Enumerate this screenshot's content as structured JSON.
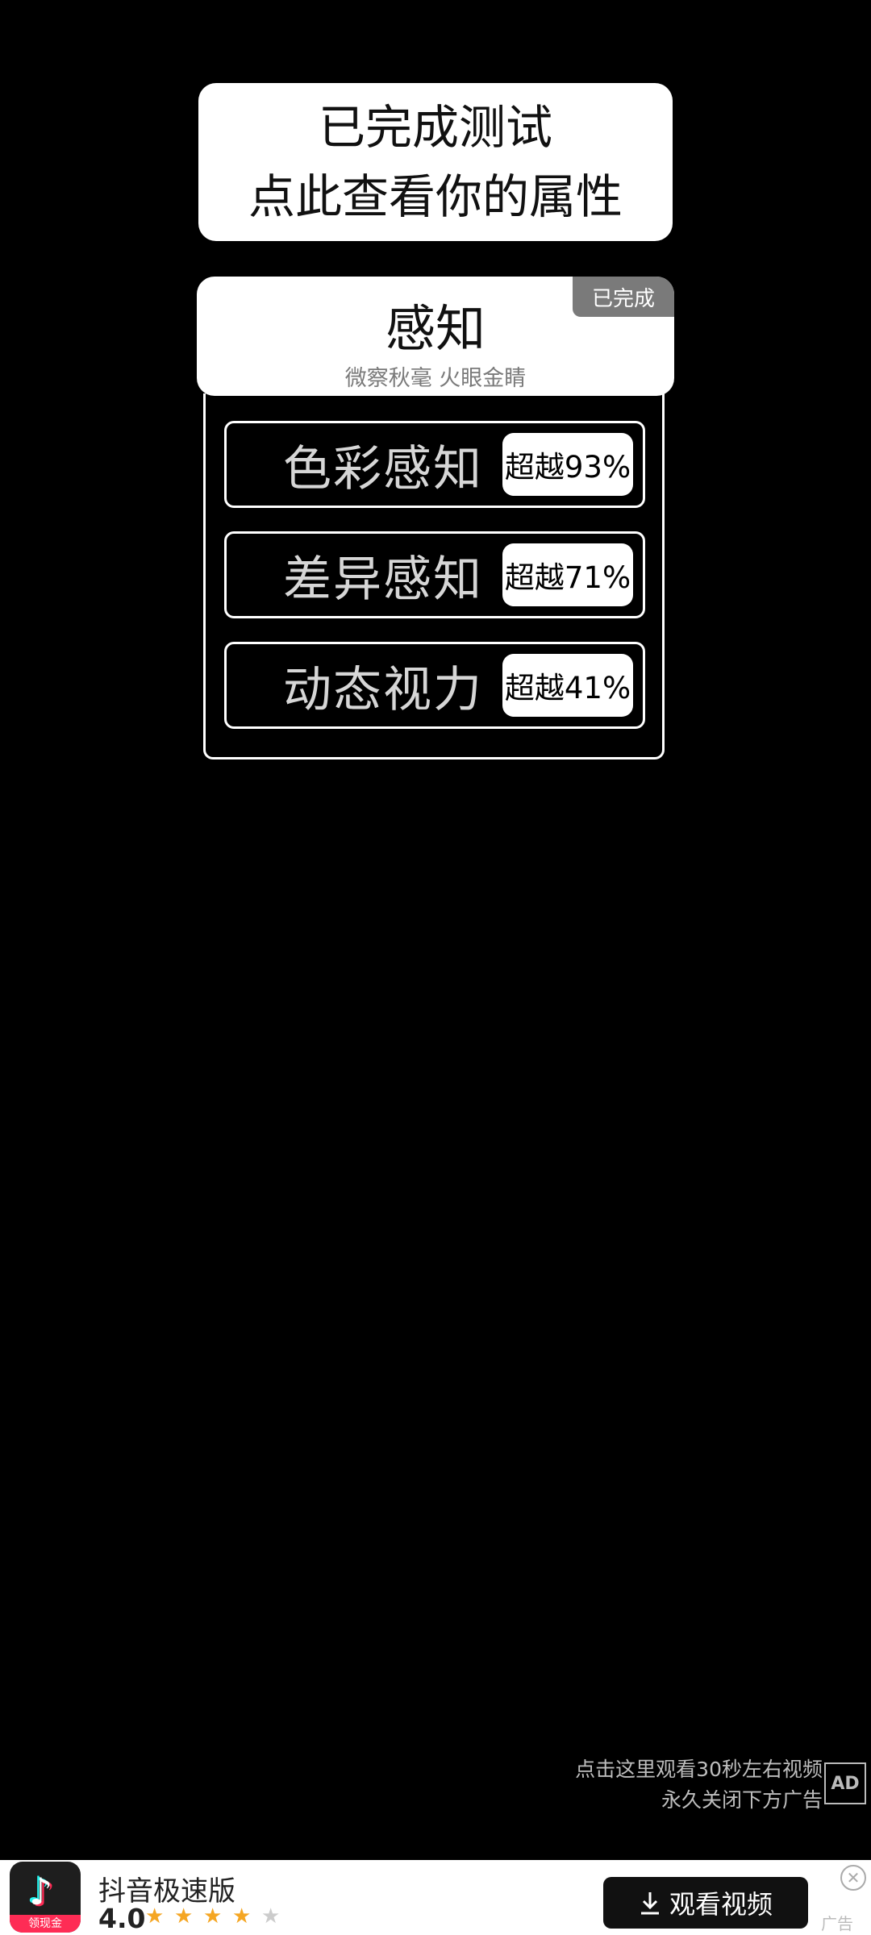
{
  "banner": {
    "line1": "已完成测试",
    "line2": "点此查看你的属性"
  },
  "category": {
    "badge": "已完成",
    "title": "感知",
    "subtitle": "微察秋毫 火眼金睛"
  },
  "stats": [
    {
      "label": "色彩感知",
      "value": "超越93%"
    },
    {
      "label": "差异感知",
      "value": "超越71%"
    },
    {
      "label": "动态视力",
      "value": "超越41%"
    }
  ],
  "ad_hint": {
    "line1": "点击这里观看30秒左右视频",
    "line2": "永久关闭下方广告",
    "icon": "AD"
  },
  "ad": {
    "logo_tag": "领现金",
    "app_name": "抖音极速版",
    "rating": "4.0",
    "stars_filled": 4,
    "stars_total": 5,
    "cta_label": "观看视频",
    "label": "广告",
    "star_color": "#f5a623",
    "star_empty_color": "#cccccc"
  }
}
